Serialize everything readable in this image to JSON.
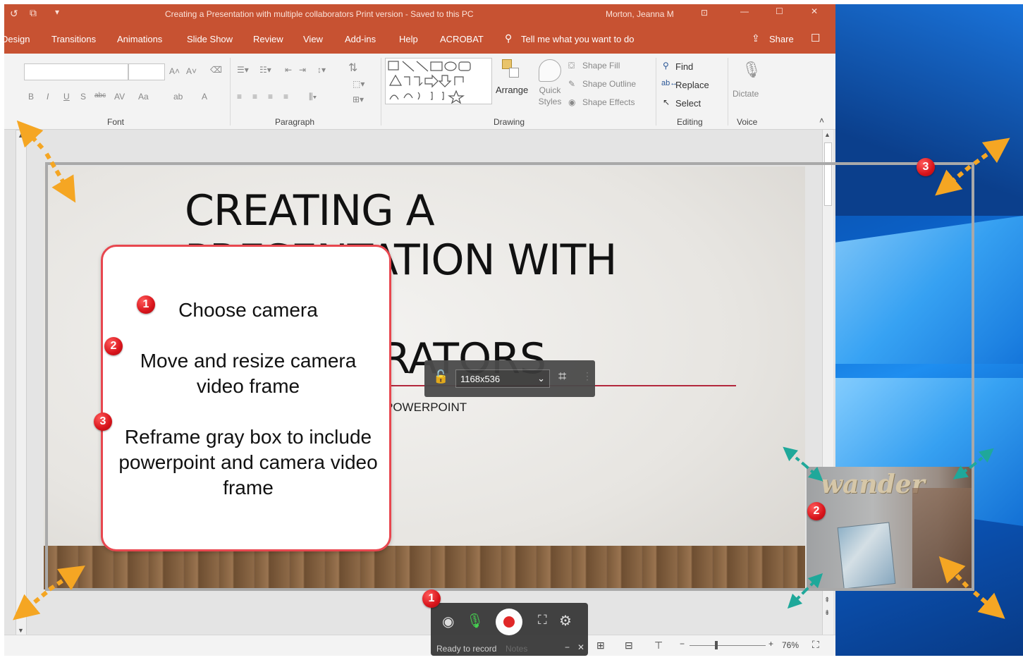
{
  "window": {
    "title": "Creating a Presentation with multiple collaborators Print version  -  Saved to this PC",
    "user": "Morton, Jeanna M"
  },
  "menu": {
    "items": [
      "Design",
      "Transitions",
      "Animations",
      "Slide Show",
      "Review",
      "View",
      "Add-ins",
      "Help",
      "ACROBAT"
    ],
    "tell_me": "Tell me what you want to do",
    "share": "Share"
  },
  "ribbon": {
    "groups": {
      "font": "Font",
      "paragraph": "Paragraph",
      "drawing": "Drawing",
      "editing": "Editing",
      "voice": "Voice"
    },
    "font_buttons": [
      "B",
      "I",
      "U",
      "S",
      "abc",
      "AV",
      "Aa",
      "A"
    ],
    "drawing": {
      "arrange": "Arrange",
      "quick_styles": "Quick Styles",
      "shape_fill": "Shape Fill",
      "shape_outline": "Shape Outline",
      "shape_effects": "Shape Effects"
    },
    "editing": {
      "find": "Find",
      "replace": "Replace",
      "select": "Select"
    },
    "voice": {
      "dictate": "Dictate"
    }
  },
  "slide": {
    "title_line1": "CREATING A",
    "title_line2": "PRESENTATION WITH",
    "title_line4": "COLLABORATORS",
    "subtitle": "POWERPOINT"
  },
  "callout": {
    "step1": "Choose camera",
    "step2": "Move and resize camera video frame",
    "step3": "Reframe gray box to include powerpoint and camera video frame"
  },
  "badges": {
    "one": "1",
    "two": "2",
    "three": "3"
  },
  "crop_toolbar": {
    "resolution": "1168x536"
  },
  "camera_preview": {
    "word": "wander"
  },
  "recorder": {
    "status": "Ready to record",
    "notes": "Notes"
  },
  "statusbar": {
    "zoom": "76%"
  },
  "colors": {
    "titlebar": "#c75232",
    "accent_red": "#e8474f",
    "badge_red": "#d8141b",
    "arrow_orange": "#f5a623",
    "arrow_teal": "#1fa89a"
  }
}
